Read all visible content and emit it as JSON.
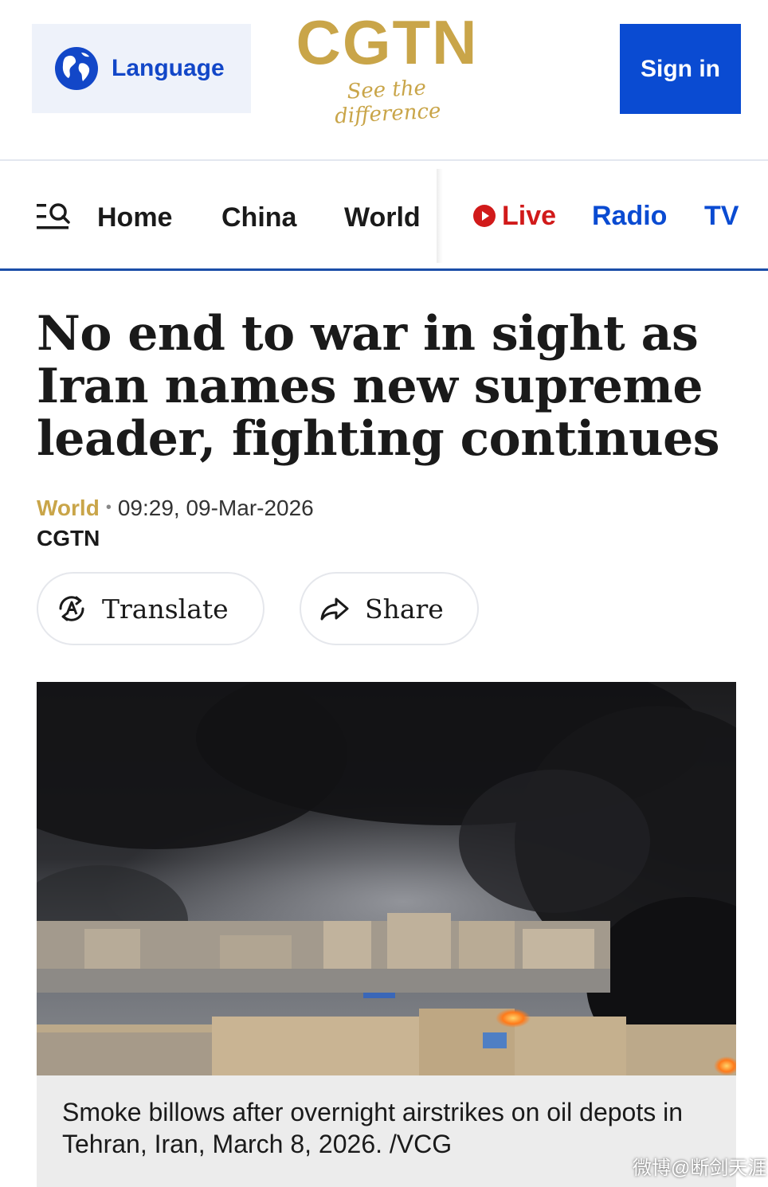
{
  "header": {
    "language_label": "Language",
    "logo_text": "CGTN",
    "logo_tagline": "See the difference",
    "signin_label": "Sign in"
  },
  "nav": {
    "items": [
      {
        "label": "Home"
      },
      {
        "label": "China"
      },
      {
        "label": "World"
      },
      {
        "label": "Live"
      },
      {
        "label": "Radio"
      },
      {
        "label": "TV"
      }
    ]
  },
  "article": {
    "headline": "No end to war in sight as Iran names new supreme leader, fighting continues",
    "category": "World",
    "datetime": "09:29, 09-Mar-2026",
    "source": "CGTN",
    "translate_label": "Translate",
    "share_label": "Share",
    "image_caption": "Smoke billows after overnight airstrikes on oil depots in Tehran, Iran, March 8, 2026. /VCG"
  },
  "watermark": "微博@断剑天涯",
  "colors": {
    "brand_blue": "#0a4bd2",
    "logo_gold": "#c9a549",
    "live_red": "#d11a1a",
    "nav_rule": "#1b4ea8"
  },
  "icons": {
    "language": "globe-icon",
    "menu": "menu-search-icon",
    "live": "live-play-icon",
    "translate": "translate-icon",
    "share": "share-arrow-icon"
  }
}
